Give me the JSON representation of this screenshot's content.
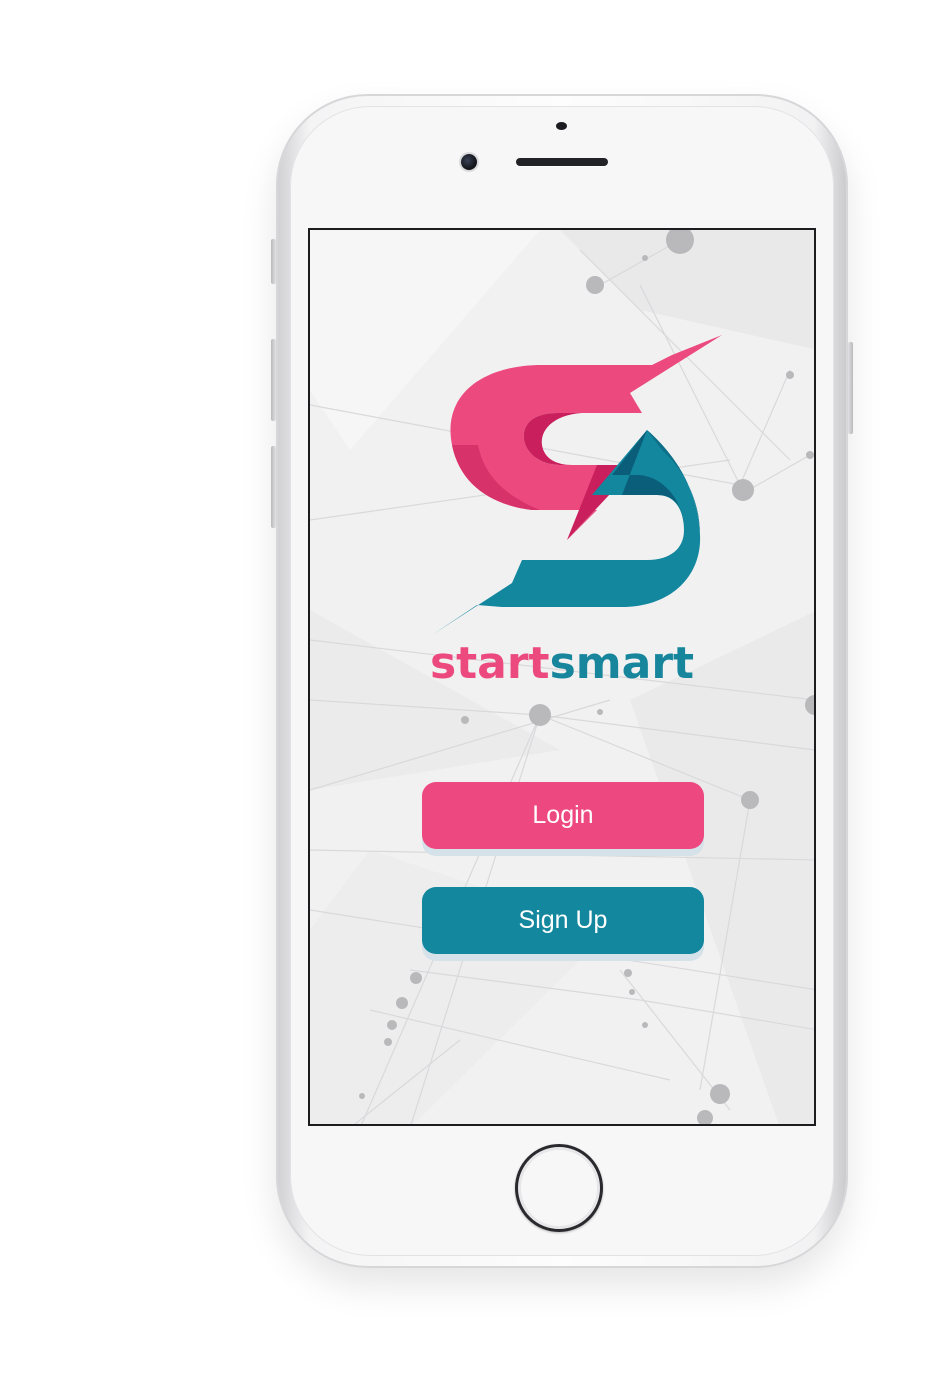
{
  "app": {
    "brand_part1": "start",
    "brand_part2": "smart"
  },
  "buttons": {
    "login_label": "Login",
    "signup_label": "Sign Up"
  },
  "colors": {
    "pink": "#ee4880",
    "teal": "#12879e",
    "logo_pink_dark": "#c91f5c",
    "logo_teal_dark": "#0b5e79",
    "button_shadow": "#d5e2ea"
  },
  "icons": {
    "logo": "s-lightning-logo-icon",
    "home": "home-button"
  }
}
